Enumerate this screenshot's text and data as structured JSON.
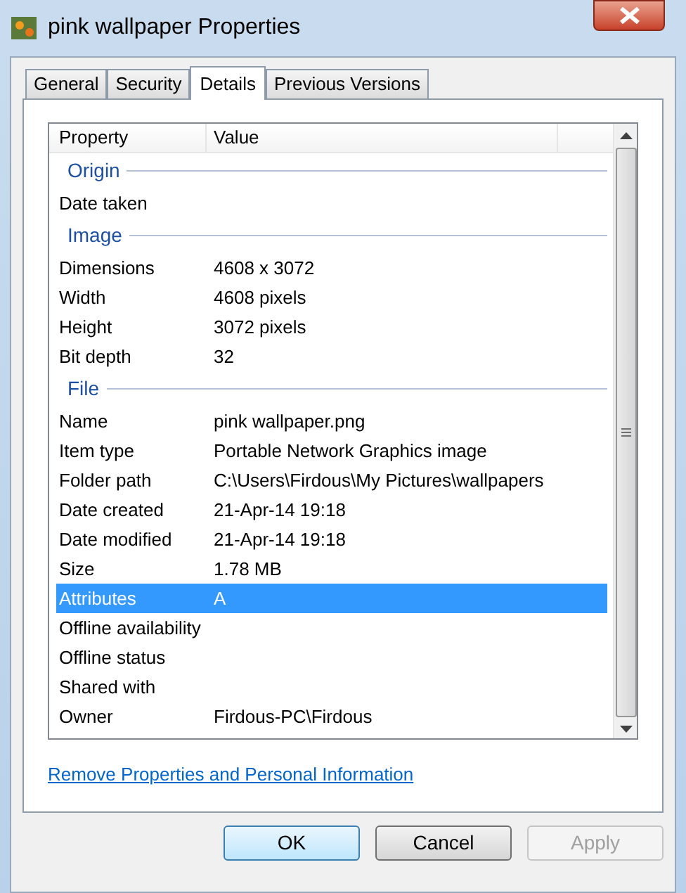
{
  "window": {
    "title": "pink wallpaper Properties"
  },
  "tabs": [
    {
      "label": "General",
      "selected": false
    },
    {
      "label": "Security",
      "selected": false
    },
    {
      "label": "Details",
      "selected": true
    },
    {
      "label": "Previous Versions",
      "selected": false
    }
  ],
  "table": {
    "columns": [
      "Property",
      "Value"
    ],
    "groups": [
      {
        "title": "Origin",
        "rows": [
          {
            "property": "Date taken",
            "value": "",
            "selected": false
          }
        ]
      },
      {
        "title": "Image",
        "rows": [
          {
            "property": "Dimensions",
            "value": "4608 x 3072",
            "selected": false
          },
          {
            "property": "Width",
            "value": "4608 pixels",
            "selected": false
          },
          {
            "property": "Height",
            "value": "3072 pixels",
            "selected": false
          },
          {
            "property": "Bit depth",
            "value": "32",
            "selected": false
          }
        ]
      },
      {
        "title": "File",
        "rows": [
          {
            "property": "Name",
            "value": "pink wallpaper.png",
            "selected": false
          },
          {
            "property": "Item type",
            "value": "Portable Network Graphics image",
            "selected": false
          },
          {
            "property": "Folder path",
            "value": "C:\\Users\\Firdous\\My Pictures\\wallpapers",
            "selected": false
          },
          {
            "property": "Date created",
            "value": "21-Apr-14 19:18",
            "selected": false
          },
          {
            "property": "Date modified",
            "value": "21-Apr-14 19:18",
            "selected": false
          },
          {
            "property": "Size",
            "value": "1.78 MB",
            "selected": false
          },
          {
            "property": "Attributes",
            "value": "A",
            "selected": true
          },
          {
            "property": "Offline availability",
            "value": "",
            "selected": false
          },
          {
            "property": "Offline status",
            "value": "",
            "selected": false
          },
          {
            "property": "Shared with",
            "value": "",
            "selected": false
          },
          {
            "property": "Owner",
            "value": "Firdous-PC\\Firdous",
            "selected": false
          }
        ]
      }
    ]
  },
  "link": "Remove Properties and Personal Information",
  "buttons": [
    {
      "label": "OK",
      "kind": "default",
      "disabled": false
    },
    {
      "label": "Cancel",
      "kind": "normal",
      "disabled": false
    },
    {
      "label": "Apply",
      "kind": "normal",
      "disabled": true
    }
  ]
}
